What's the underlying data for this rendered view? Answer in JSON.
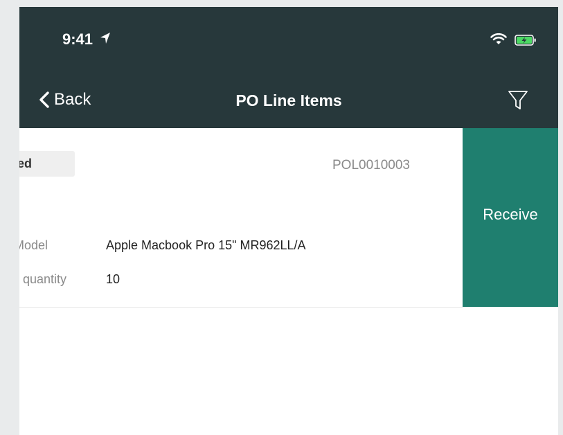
{
  "statusbar": {
    "time": "9:41",
    "location_icon": "location-arrow-icon",
    "wifi_icon": "wifi-icon",
    "battery_icon": "battery-charging-icon"
  },
  "navbar": {
    "back_label": "Back",
    "title": "PO Line Items",
    "filter_icon": "filter-icon"
  },
  "line_item": {
    "state": "red",
    "number": "POL0010003",
    "fields": [
      {
        "label": "Model",
        "value": "Apple Macbook Pro 15\" MR962LL/A"
      },
      {
        "label": "g quantity",
        "value": "10"
      }
    ],
    "swipe_action": "Receive"
  },
  "colors": {
    "header_bg": "#27383b",
    "action_bg": "#1f7f6f",
    "battery_green": "#4cd964"
  }
}
